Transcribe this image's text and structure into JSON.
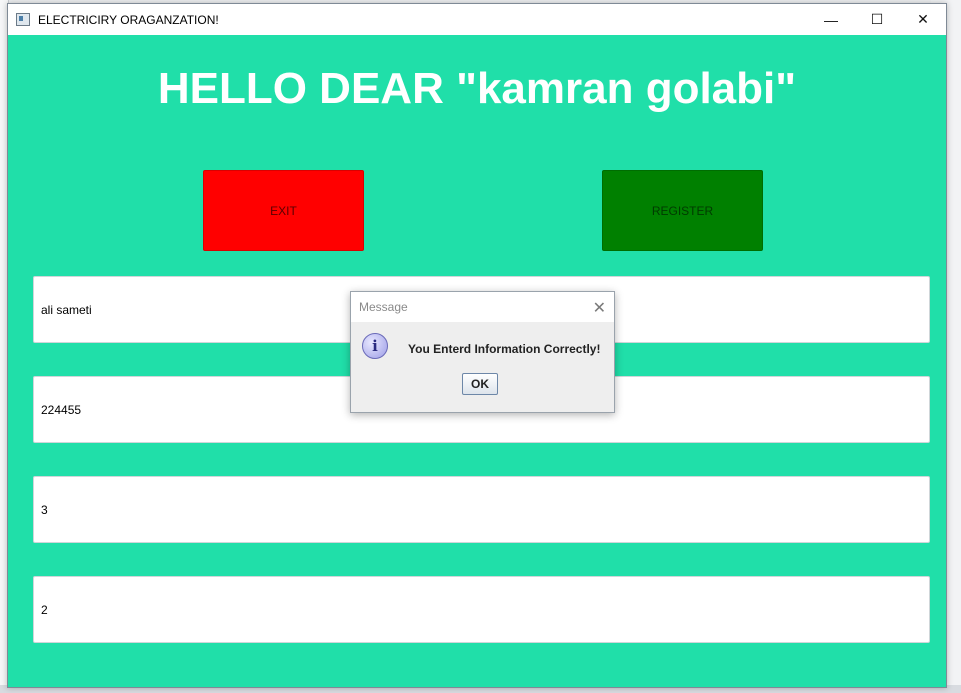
{
  "window": {
    "title": "ELECTRICIRY ORAGANZATION!",
    "controls": {
      "minimize": "—",
      "maximize": "☐",
      "close": "✕"
    }
  },
  "main": {
    "heading": "HELLO DEAR \"kamran golabi\"",
    "exit_label": "EXIT",
    "register_label": "REGISTER",
    "fields": [
      "ali sameti",
      "224455",
      "3",
      "2"
    ]
  },
  "dialog": {
    "title": "Message",
    "message": "You Enterd Information Correctly!",
    "ok_label": "OK",
    "icon": "info-icon"
  },
  "colors": {
    "background": "#20dfa9",
    "exit": "#ff0000",
    "register": "#008000"
  }
}
